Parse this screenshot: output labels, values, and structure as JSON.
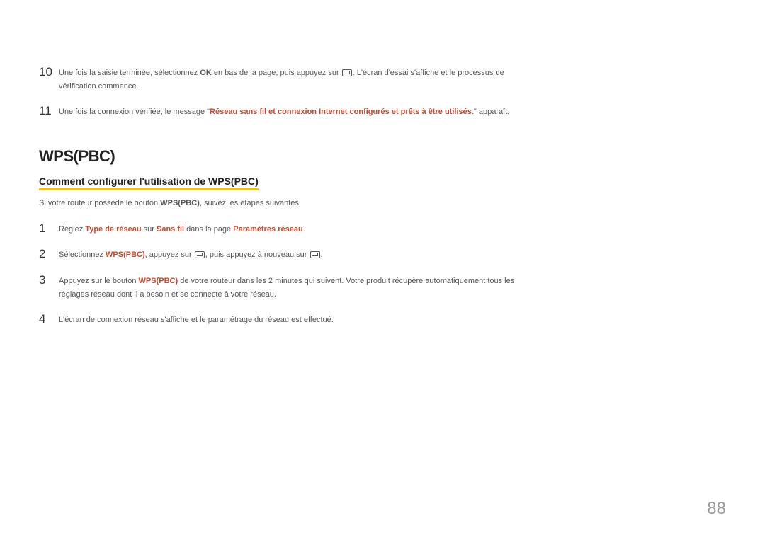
{
  "page_number": "88",
  "top_steps": [
    {
      "num": "10",
      "parts": [
        {
          "t": "Une fois la saisie terminée, sélectionnez "
        },
        {
          "t": "OK",
          "bold": true
        },
        {
          "t": " en bas de la page, puis appuyez sur "
        },
        {
          "icon": "enter"
        },
        {
          "t": ". L'écran d'essai s'affiche et le processus de vérification commence."
        }
      ]
    },
    {
      "num": "11",
      "parts": [
        {
          "t": "Une fois la connexion vérifiée, le message \""
        },
        {
          "t": "Réseau sans fil et connexion Internet configurés et prêts à être utilisés.",
          "red": true
        },
        {
          "t": "\" apparaît."
        }
      ]
    }
  ],
  "section_title": "WPS(PBC)",
  "sub_heading": "Comment configurer l'utilisation de WPS(PBC)",
  "intro_parts": [
    {
      "t": "Si votre routeur possède le bouton "
    },
    {
      "t": "WPS(PBC)",
      "bold": true
    },
    {
      "t": ", suivez les étapes suivantes."
    }
  ],
  "bottom_steps": [
    {
      "num": "1",
      "parts": [
        {
          "t": "Réglez "
        },
        {
          "t": "Type de réseau",
          "red": true
        },
        {
          "t": " sur "
        },
        {
          "t": "Sans fil",
          "red": true
        },
        {
          "t": " dans la page "
        },
        {
          "t": "Paramètres réseau",
          "red": true
        },
        {
          "t": "."
        }
      ]
    },
    {
      "num": "2",
      "parts": [
        {
          "t": "Sélectionnez "
        },
        {
          "t": "WPS(PBC)",
          "red": true
        },
        {
          "t": ", appuyez sur "
        },
        {
          "icon": "enter"
        },
        {
          "t": ", puis appuyez à nouveau sur "
        },
        {
          "icon": "enter"
        },
        {
          "t": "."
        }
      ]
    },
    {
      "num": "3",
      "parts": [
        {
          "t": "Appuyez sur le bouton "
        },
        {
          "t": "WPS(PBC)",
          "red": true
        },
        {
          "t": " de votre routeur dans les 2 minutes qui suivent. Votre produit récupère automatiquement tous les réglages réseau dont il a besoin et se connecte à votre réseau."
        }
      ]
    },
    {
      "num": "4",
      "parts": [
        {
          "t": "L'écran de connexion réseau s'affiche et le paramétrage du réseau est effectué."
        }
      ]
    }
  ]
}
